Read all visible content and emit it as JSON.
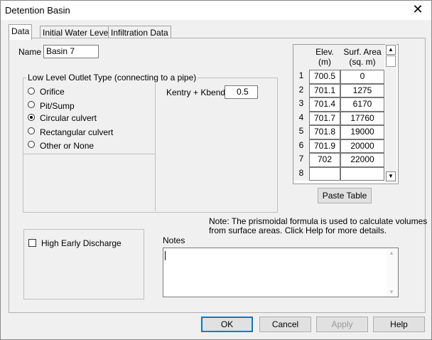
{
  "window": {
    "title": "Detention Basin",
    "close_glyph": "✕"
  },
  "tabs": [
    {
      "label": "Data",
      "active": true
    },
    {
      "label": "Initial Water Level",
      "active": false
    },
    {
      "label": "Infiltration Data",
      "active": false
    }
  ],
  "name": {
    "label": "Name",
    "value": "Basin 7"
  },
  "outlet": {
    "group_label": "Low Level Outlet Type (connecting to a pipe)",
    "options": [
      {
        "label": "Orifice",
        "selected": false
      },
      {
        "label": "Pit/Sump",
        "selected": false
      },
      {
        "label": "Circular culvert",
        "selected": true
      },
      {
        "label": "Rectangular culvert",
        "selected": false
      },
      {
        "label": "Other or None",
        "selected": false
      }
    ],
    "kentry_label": "Kentry + Kbends",
    "kentry_value": "0.5"
  },
  "table": {
    "col1_header_line1": "Elev.",
    "col1_header_line2": "(m)",
    "col2_header_line1": "Surf. Area",
    "col2_header_line2": "(sq. m)",
    "rows": [
      {
        "num": "1",
        "elev": "700.5",
        "area": "0"
      },
      {
        "num": "2",
        "elev": "701.1",
        "area": "1275"
      },
      {
        "num": "3",
        "elev": "701.4",
        "area": "6170"
      },
      {
        "num": "4",
        "elev": "701.7",
        "area": "17760"
      },
      {
        "num": "5",
        "elev": "701.8",
        "area": "19000"
      },
      {
        "num": "6",
        "elev": "701.9",
        "area": "20000"
      },
      {
        "num": "7",
        "elev": "702",
        "area": "22000"
      },
      {
        "num": "8",
        "elev": "",
        "area": ""
      }
    ]
  },
  "paste_button": "Paste Table",
  "note_line1": "Note:  The prismoidal formula is used to calculate volumes",
  "note_line2": "from surface areas.  Click Help for more details.",
  "high_early_discharge": {
    "label": "High Early Discharge",
    "checked": false
  },
  "notes": {
    "label": "Notes",
    "value": ""
  },
  "buttons": {
    "ok": "OK",
    "cancel": "Cancel",
    "apply": "Apply",
    "help": "Help"
  },
  "scroll_arrows": {
    "up": "▲",
    "down": "▼"
  }
}
